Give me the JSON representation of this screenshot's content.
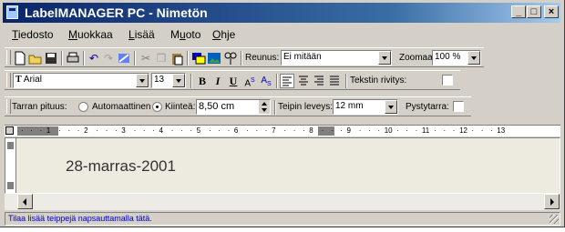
{
  "window": {
    "title": "LabelMANAGER PC - Nimetön",
    "controls": {
      "minimize": "_",
      "maximize": "□",
      "close": "×"
    }
  },
  "menu": [
    {
      "label": "Tiedosto",
      "mnemonic": "T",
      "rest": "iedosto"
    },
    {
      "label": "Muokkaa",
      "mnemonic": "M",
      "rest": "uokkaa"
    },
    {
      "label": "Lisää",
      "mnemonic": "L",
      "rest": "isää"
    },
    {
      "label": "Muoto",
      "pre": "M",
      "mnemonic": "u",
      "rest": "oto"
    },
    {
      "label": "Ohje",
      "mnemonic": "O",
      "rest": "hje"
    }
  ],
  "toolbar1": {
    "reunus_label": "Reunus:",
    "reunus_value": "Ei mitään",
    "zoom_label": "Zoomaa:",
    "zoom_value": "100 %"
  },
  "toolbar2": {
    "font_value": "Arial",
    "size_value": "13",
    "bold": "B",
    "italic": "I",
    "underline": "U",
    "superscript": "A",
    "superscript_mark": "S",
    "subscript": "A",
    "subscript_mark": "S",
    "wrap_label": "Tekstin rivitys:"
  },
  "toolbar3": {
    "length_label": "Tarran pituus:",
    "auto_label": "Automaattinen",
    "fixed_label": "Kiinteä:",
    "length_value": "8,50 cm",
    "tape_width_label": "Teipin leveys:",
    "tape_width_value": "12 mm",
    "vertical_label": "Pystytarra:"
  },
  "ruler": {
    "numbers": [
      "1",
      "2",
      "3",
      "4",
      "5",
      "6",
      "7",
      "8",
      "9",
      "10",
      "11",
      "12",
      "13"
    ]
  },
  "document": {
    "label_text": "28-marras-2001"
  },
  "status": {
    "text": "Tilaa lisää teippejä napsauttamalla tätä."
  }
}
